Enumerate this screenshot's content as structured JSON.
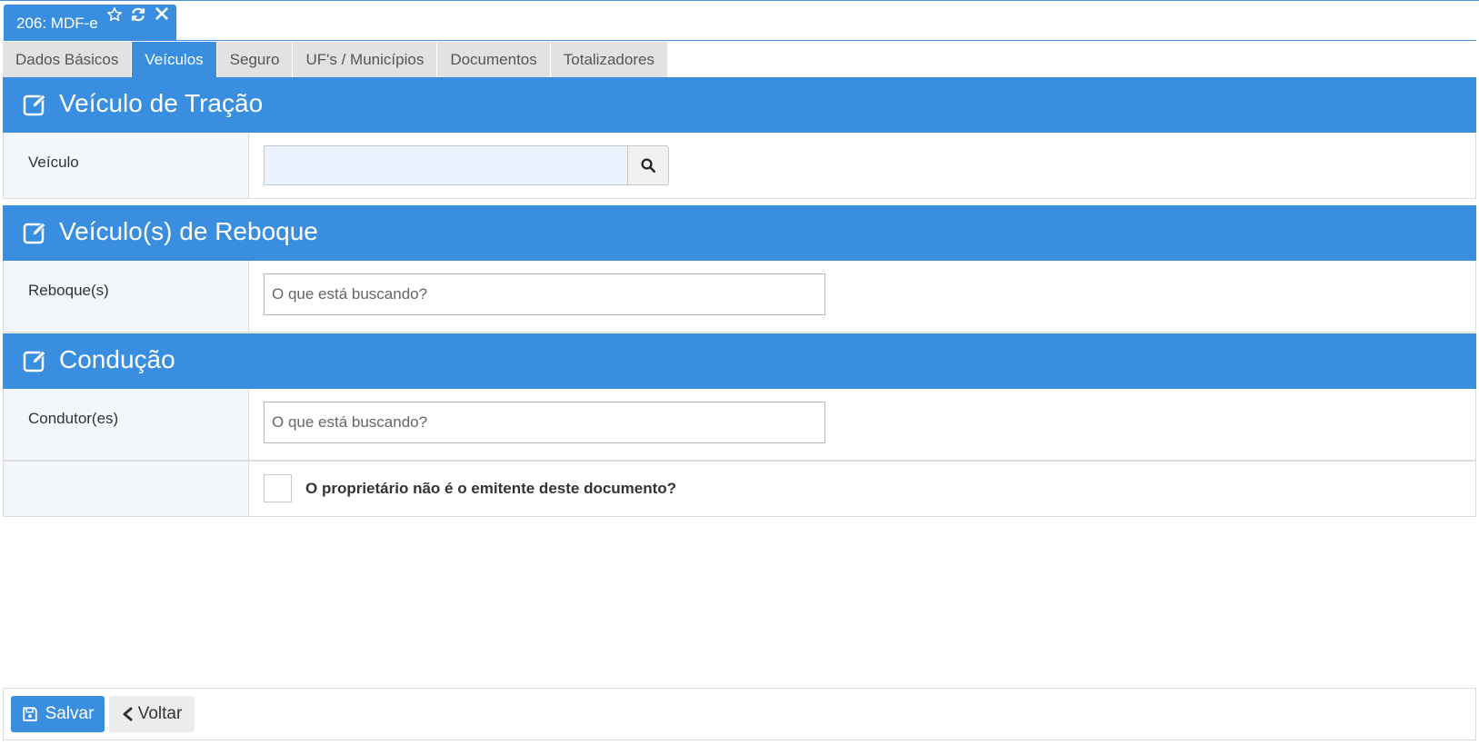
{
  "document_tab": {
    "title": "206: MDF-e",
    "icons": [
      "star-icon",
      "refresh-icon",
      "close-icon"
    ]
  },
  "tabs": [
    {
      "label": "Dados Básicos",
      "active": false
    },
    {
      "label": "Veículos",
      "active": true
    },
    {
      "label": "Seguro",
      "active": false
    },
    {
      "label": "UF's / Municípios",
      "active": false
    },
    {
      "label": "Documentos",
      "active": false
    },
    {
      "label": "Totalizadores",
      "active": false
    }
  ],
  "sections": {
    "tracao": {
      "title": "Veículo de Tração",
      "veiculo_label": "Veículo",
      "veiculo_value": ""
    },
    "reboque": {
      "title": "Veículo(s) de Reboque",
      "reboques_label": "Reboque(s)",
      "reboques_placeholder": "O que está buscando?"
    },
    "conducao": {
      "title": "Condução",
      "condutores_label": "Condutor(es)",
      "condutores_placeholder": "O que está buscando?",
      "proprietario_label": "O proprietário não é o emitente deste documento?",
      "proprietario_checked": false
    }
  },
  "footer": {
    "save_label": "Salvar",
    "back_label": "Voltar"
  },
  "colors": {
    "accent": "#3a8ee0",
    "label_bg": "#f3f7fc",
    "tab_bg": "#e2e2e2",
    "input_bg": "#eaf2fd"
  }
}
